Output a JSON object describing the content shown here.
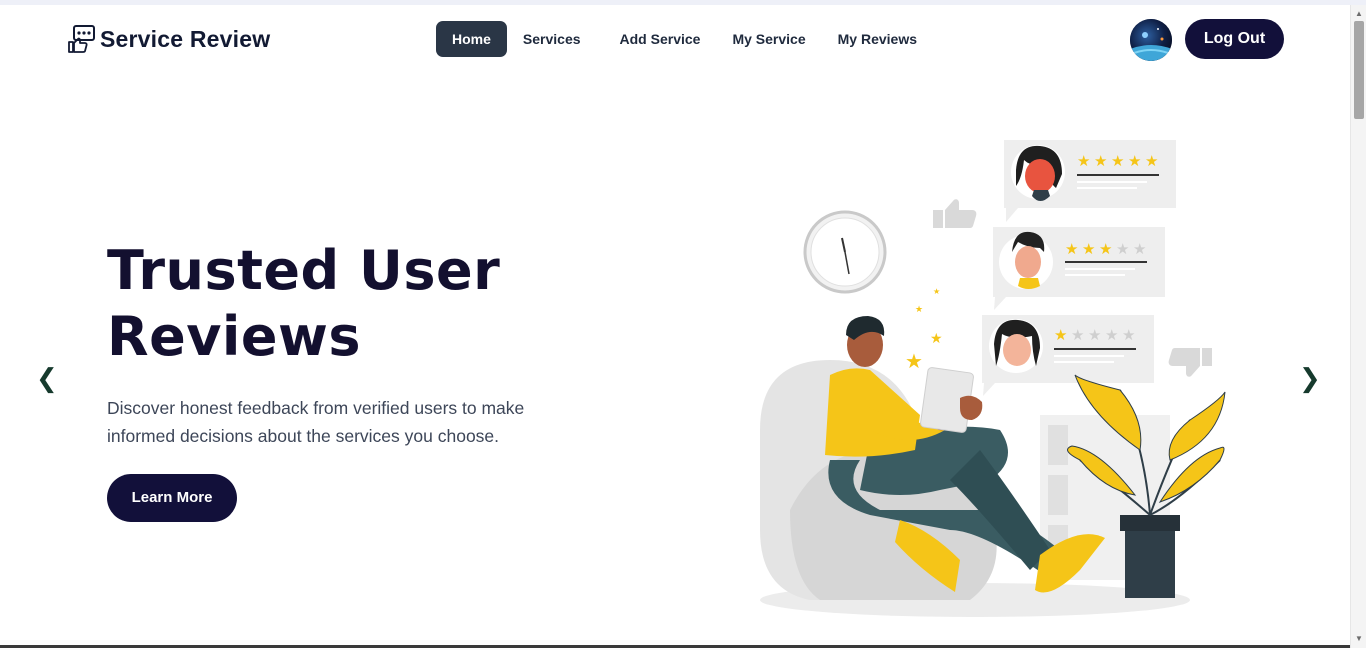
{
  "brand": {
    "name": "Service Review",
    "logo_icon": "review-board-icon"
  },
  "nav": {
    "items": [
      {
        "label": "Home",
        "active": true
      },
      {
        "label": "Services",
        "active": false
      },
      {
        "label": "Add Service",
        "active": false
      },
      {
        "label": "My Service",
        "active": false
      },
      {
        "label": "My Reviews",
        "active": false
      }
    ]
  },
  "user": {
    "avatar_icon": "user-avatar",
    "logout_label": "Log Out"
  },
  "hero": {
    "title": "Trusted User Reviews",
    "description": "Discover honest feedback from verified users to make informed decisions about the services you choose.",
    "cta_label": "Learn More",
    "prev_arrow": "❮",
    "next_arrow": "❯",
    "illustration": {
      "reviews": [
        {
          "stars": 5,
          "out_of": 5
        },
        {
          "stars": 3,
          "out_of": 5
        },
        {
          "stars": 1,
          "out_of": 5
        }
      ]
    }
  },
  "colors": {
    "primary": "#12103a",
    "nav_active": "#2a3646",
    "accent_yellow": "#f5c518",
    "arrow": "#163a2d"
  }
}
